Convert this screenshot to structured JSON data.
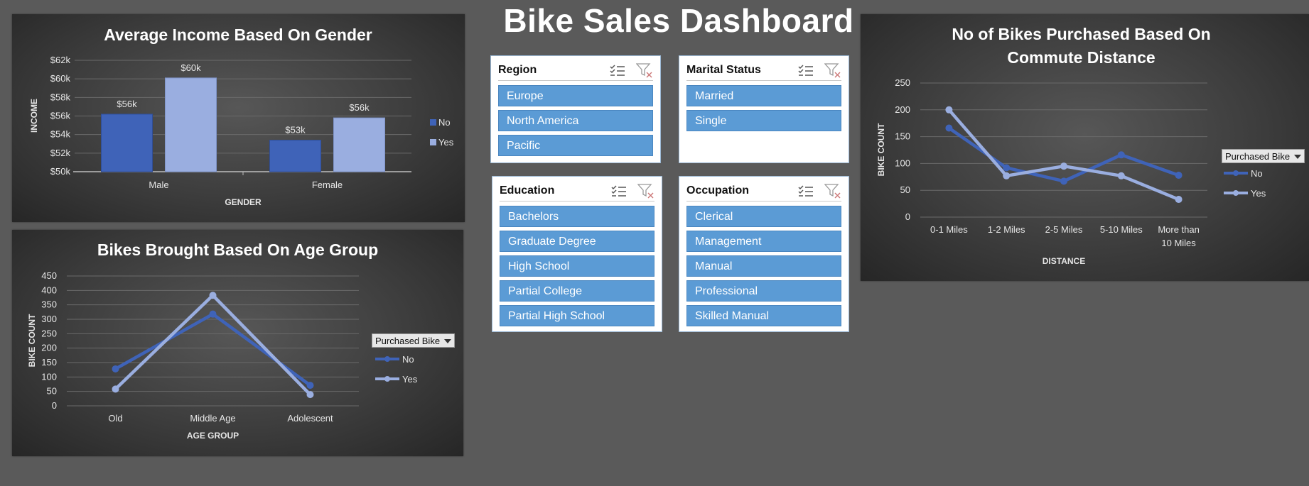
{
  "dashboard": {
    "title": "Bike Sales Dashboard"
  },
  "colors": {
    "no": "#3f63b8",
    "yes": "#9aaee0",
    "slicer_item": "#5b9bd5"
  },
  "slicers": [
    {
      "title": "Region",
      "items": [
        "Europe",
        "North America",
        "Pacific"
      ]
    },
    {
      "title": "Marital Status",
      "items": [
        "Married",
        "Single"
      ]
    },
    {
      "title": "Education",
      "items": [
        "Bachelors",
        "Graduate Degree",
        "High School",
        "Partial College",
        "Partial High School"
      ]
    },
    {
      "title": "Occupation",
      "items": [
        "Clerical",
        "Management",
        "Manual",
        "Professional",
        "Skilled Manual"
      ]
    }
  ],
  "slicer_icons": [
    "multi-select-icon",
    "clear-filter-icon"
  ],
  "legend_dropdown_label": "Purchased Bike",
  "chart_data": [
    {
      "type": "bar",
      "title": "Average Income Based On Gender",
      "xlabel": "GENDER",
      "ylabel": "INCOME",
      "categories": [
        "Male",
        "Female"
      ],
      "series": [
        {
          "name": "No",
          "values": [
            56200,
            53400
          ],
          "labels": [
            "$56k",
            "$53k"
          ]
        },
        {
          "name": "Yes",
          "values": [
            60100,
            55800
          ],
          "labels": [
            "$60k",
            "$56k"
          ]
        }
      ],
      "ylim": [
        50000,
        62000
      ],
      "yticks": [
        "$50k",
        "$52k",
        "$54k",
        "$56k",
        "$58k",
        "$60k",
        "$62k"
      ],
      "grid": true,
      "legend": "right"
    },
    {
      "type": "line",
      "title": "Bikes Brought Based On Age Group",
      "xlabel": "AGE GROUP",
      "ylabel": "BIKE COUNT",
      "categories": [
        "Old",
        "Middle Age",
        "Adolescent"
      ],
      "series": [
        {
          "name": "No",
          "values": [
            128,
            318,
            71
          ]
        },
        {
          "name": "Yes",
          "values": [
            58,
            383,
            39
          ]
        }
      ],
      "ylim": [
        0,
        450
      ],
      "yticks": [
        "0",
        "50",
        "100",
        "150",
        "200",
        "250",
        "300",
        "350",
        "400",
        "450"
      ],
      "grid": true,
      "legend": "right"
    },
    {
      "type": "line",
      "title": "No of Bikes Purchased Based On Commute Distance",
      "xlabel": "DISTANCE",
      "ylabel": "BIKE COUNT",
      "categories": [
        "0-1 Miles",
        "1-2 Miles",
        "2-5 Miles",
        "5-10 Miles",
        "More than 10 Miles"
      ],
      "series": [
        {
          "name": "No",
          "values": [
            166,
            92,
            67,
            116,
            78
          ]
        },
        {
          "name": "Yes",
          "values": [
            200,
            77,
            95,
            77,
            33
          ]
        }
      ],
      "ylim": [
        0,
        250
      ],
      "yticks": [
        "0",
        "50",
        "100",
        "150",
        "200",
        "250"
      ],
      "grid": true,
      "legend": "right"
    }
  ]
}
